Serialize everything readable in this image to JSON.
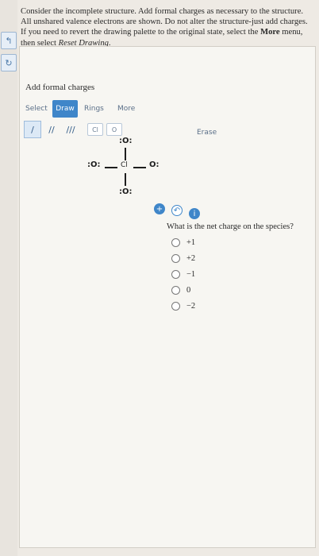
{
  "instructions": {
    "line1": "Consider the incomplete structure. Add formal charges as necessary to the structure. All unshared valence electrons are shown.",
    "line2_a": "Do not alter the structure-just add charges. If you need to revert the drawing palette to the original state, select the ",
    "line2_more": "More",
    "line2_b": " menu,",
    "line3_a": "then select ",
    "line3_reset": "Reset Drawing",
    "line3_b": "."
  },
  "editor": {
    "title": "Add formal charges",
    "tabs": [
      "Select",
      "Draw",
      "Rings",
      "More"
    ],
    "active_tab": "Draw",
    "erase_label": "Erase",
    "bonds": [
      "/",
      "//",
      "///"
    ],
    "element_chips": [
      "Cl",
      "O"
    ]
  },
  "molecule": {
    "center": "Cl",
    "top": ":O:",
    "left": ":O:",
    "right": "O:",
    "bottom": ":O:"
  },
  "question": {
    "text": "What is the net charge on the species?",
    "options": [
      "+1",
      "+2",
      "−1",
      "0",
      "−2"
    ]
  },
  "controls": [
    "zoom-in",
    "undo",
    "info"
  ]
}
